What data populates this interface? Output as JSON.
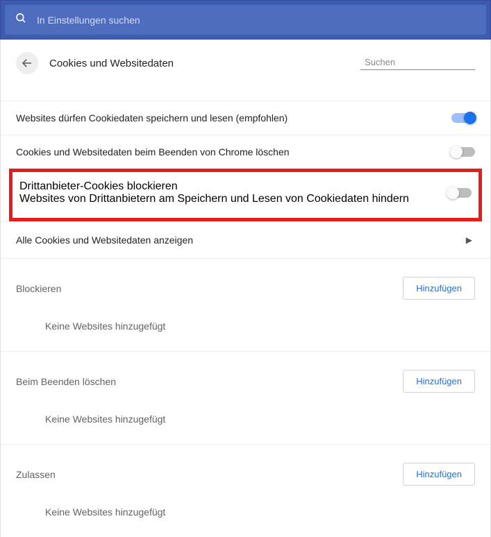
{
  "topSearch": {
    "placeholder": "In Einstellungen suchen"
  },
  "header": {
    "title": "Cookies und Websitedaten",
    "searchPlaceholder": "Suchen"
  },
  "settings": {
    "allowCookies": {
      "label": "Websites dürfen Cookiedaten speichern und lesen (empfohlen)",
      "enabled": true
    },
    "clearOnExit": {
      "label": "Cookies und Websitedaten beim Beenden von Chrome löschen",
      "enabled": false
    },
    "blockThirdParty": {
      "label": "Drittanbieter-Cookies blockieren",
      "description": "Websites von Drittanbietern am Speichern und Lesen von Cookiedaten hindern",
      "enabled": false
    },
    "viewAll": {
      "label": "Alle Cookies und Websitedaten anzeigen"
    }
  },
  "sections": {
    "block": {
      "title": "Blockieren",
      "addLabel": "Hinzufügen",
      "empty": "Keine Websites hinzugefügt"
    },
    "clearOnExit": {
      "title": "Beim Beenden löschen",
      "addLabel": "Hinzufügen",
      "empty": "Keine Websites hinzugefügt"
    },
    "allow": {
      "title": "Zulassen",
      "addLabel": "Hinzufügen",
      "empty": "Keine Websites hinzugefügt"
    }
  }
}
